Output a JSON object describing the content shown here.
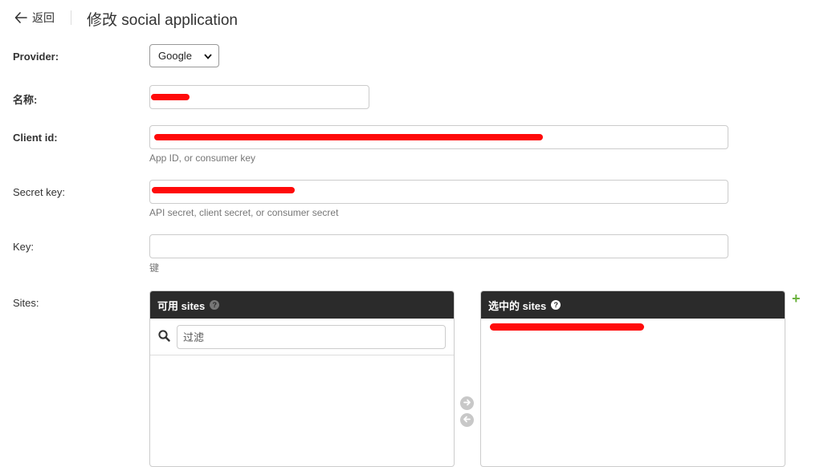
{
  "header": {
    "back_label": "返回",
    "title": "修改 social application"
  },
  "form": {
    "provider": {
      "label": "Provider:",
      "value": "Google"
    },
    "name": {
      "label": "名称:",
      "value": ""
    },
    "client_id": {
      "label": "Client id:",
      "value": "",
      "help": "App ID, or consumer key"
    },
    "secret_key": {
      "label": "Secret key:",
      "value": "",
      "help": "API secret, client secret, or consumer secret"
    },
    "key": {
      "label": "Key:",
      "value": "",
      "help": "键"
    },
    "sites": {
      "label": "Sites:",
      "available_title": "可用 sites",
      "filter_placeholder": "过滤",
      "chosen_title": "选中的 sites",
      "add_symbol": "+"
    }
  },
  "colors": {
    "selector_header": "#2b2b2b",
    "redaction": "#ff0a0a",
    "add_link": "#6cb33e"
  }
}
